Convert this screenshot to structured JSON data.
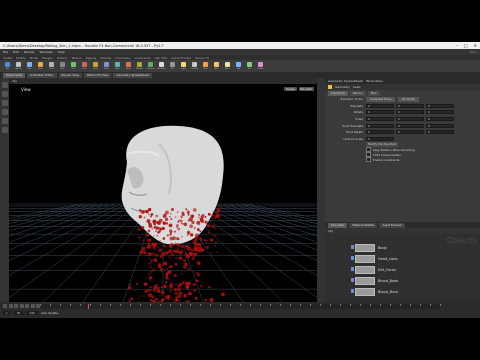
{
  "titlebar": {
    "title": "C:/Users/Steve/Desktop/Rolling_Skin_1.hipnc - Houdini FX Non-Commercial 16.0.557 - Py2.7"
  },
  "menu": {
    "items": [
      "File",
      "Edit",
      "Render",
      "Windows",
      "Help"
    ],
    "desktop": "Main",
    "build": "Build"
  },
  "shelf_tabs": [
    "Create",
    "Modify",
    "Model",
    "Polygon",
    "Deform",
    "Texture",
    "Rigging",
    "Muscles",
    "Characters",
    "Constraints",
    "Hair Utils",
    "Guide Process",
    "Terrain FX"
  ],
  "shelf_tools": [
    {
      "label": "Box",
      "color": "#4a90d9"
    },
    {
      "label": "Sphere",
      "color": "#c0c0c0"
    },
    {
      "label": "Tube",
      "color": "#7fb3e6"
    },
    {
      "label": "Torus",
      "color": "#e6a94a"
    },
    {
      "label": "Grid",
      "color": "#b4b4b4"
    },
    {
      "label": "Null",
      "color": "#888"
    },
    {
      "label": "Line",
      "color": "#6ec36e"
    },
    {
      "label": "Circle",
      "color": "#c86464"
    },
    {
      "label": "Curve",
      "color": "#c8a03c"
    },
    {
      "label": "Draw",
      "color": "#8c8cd2"
    },
    {
      "label": "Path",
      "color": "#5ab4b4"
    },
    {
      "label": "Spray",
      "color": "#d27850"
    },
    {
      "label": "Platonic",
      "color": "#aaaa3c"
    },
    {
      "label": "L-System",
      "color": "#64aa64"
    },
    {
      "label": "Metaball",
      "color": "#dcdcdc"
    },
    {
      "label": "File",
      "color": "#969696"
    },
    {
      "label": "Lights",
      "color": "#f0dc64"
    },
    {
      "label": "Camera",
      "color": "#c8c8c8"
    },
    {
      "label": "Point",
      "color": "#f0a03c"
    },
    {
      "label": "Spot",
      "color": "#f0c864"
    },
    {
      "label": "Area",
      "color": "#f0e6a0"
    },
    {
      "label": "Sky",
      "color": "#78b4f0"
    },
    {
      "label": "Env",
      "color": "#8cc88c"
    },
    {
      "label": "Caustic",
      "color": "#dc8cdc"
    }
  ],
  "pane_tabs": [
    "Scene View",
    "Animation Editor",
    "Render View",
    "Motion FX View",
    "Geometry Spreadsheet"
  ],
  "param_tabs_header": [
    "Geometry Spreadsheet",
    "Parameters"
  ],
  "viewport": {
    "label": "View",
    "cam": "Persp",
    "cam2": "No cam",
    "wireframe_color": "#3a4a5a",
    "blood_color": "#b01010"
  },
  "params": {
    "node_type": "Geometry",
    "node_name": "head",
    "tabs": [
      "Transform",
      "Render",
      "Misc"
    ],
    "row_transform_order": "Transform Order",
    "transform_order_value": "Scale Rot Trans",
    "rotate_order_value": "Rx Ry Rz",
    "rows": [
      "Translate",
      "Rotate",
      "Scale",
      "Pivot Translate",
      "Pivot Rotate",
      "Uniform Scale"
    ],
    "values": [
      "0",
      "0",
      "0"
    ],
    "modify_button": "Modify Pre-Transform",
    "checks": [
      "Keep Position When Parenting",
      "Child Compensation",
      "Enable Constraints"
    ]
  },
  "network": {
    "tabs": [
      "Tree View",
      "Material Palette",
      "Asset Browser"
    ],
    "path": "obj",
    "watermark": "Objects",
    "nodes": [
      {
        "label": "Body",
        "selected": false
      },
      {
        "label": "Head_class",
        "selected": false
      },
      {
        "label": "Dirt_Faces",
        "selected": false
      },
      {
        "label": "Blood_Book",
        "selected": false
      },
      {
        "label": "Blood_Buck",
        "selected": false
      }
    ]
  },
  "timeline": {
    "frame_start": "1",
    "frame_end": "240",
    "current_frame": "30",
    "auto_update": "Auto Update"
  }
}
